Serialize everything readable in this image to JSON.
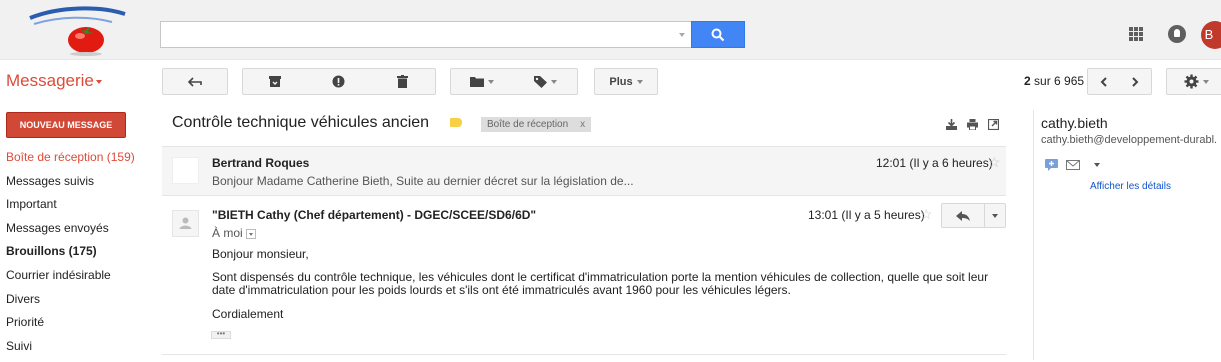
{
  "search": {
    "placeholder": "",
    "value": ""
  },
  "header": {
    "app_title": "Messagerie",
    "avatar_letter": "B"
  },
  "toolbar": {
    "more_label": "Plus",
    "count_current": "2",
    "count_separator": " sur ",
    "count_total": "6 965"
  },
  "compose_label": "NOUVEAU MESSAGE",
  "sidebar": {
    "items": [
      {
        "label": "Boîte de réception (159)"
      },
      {
        "label": "Messages suivis"
      },
      {
        "label": "Important"
      },
      {
        "label": "Messages envoyés"
      },
      {
        "label": "Brouillons (175)"
      },
      {
        "label": "Courrier indésirable"
      },
      {
        "label": "Divers"
      },
      {
        "label": "Priorité"
      },
      {
        "label": "Suivi"
      }
    ]
  },
  "thread": {
    "subject": "Contrôle technique véhicules ancien",
    "label_chip": "Boîte de réception",
    "label_chip_close": "x",
    "messages": [
      {
        "sender": "Bertrand Roques",
        "time": "12:01 (Il y a 6 heures)",
        "snippet": "Bonjour Madame Catherine Bieth, Suite au dernier décret sur la législation de..."
      },
      {
        "sender": "\"BIETH Cathy (Chef département) - DGEC/SCEE/SD6/6D\"",
        "time": "13:01 (Il y a 5 heures)",
        "to": "À moi",
        "greeting": "Bonjour monsieur,",
        "body": "Sont dispensés du contrôle technique, les véhicules dont le certificat d'immatriculation porte la mention véhicules de collection, quelle que soit leur date d'immatriculation pour les poids lourds et s'ils ont été immatriculés avant 1960 pour les véhicules légers.",
        "closing": "Cordialement",
        "ellipsis": "•••"
      }
    ]
  },
  "contact": {
    "name": "cathy.bieth",
    "email": "cathy.bieth@developpement-durabl.",
    "details_link": "Afficher les détails"
  },
  "colors": {
    "accent_red": "#dd4b39",
    "compose_red": "#d14836",
    "search_blue": "#4285f4",
    "link_blue": "#1155cc",
    "label_yellow": "#f7d046"
  }
}
